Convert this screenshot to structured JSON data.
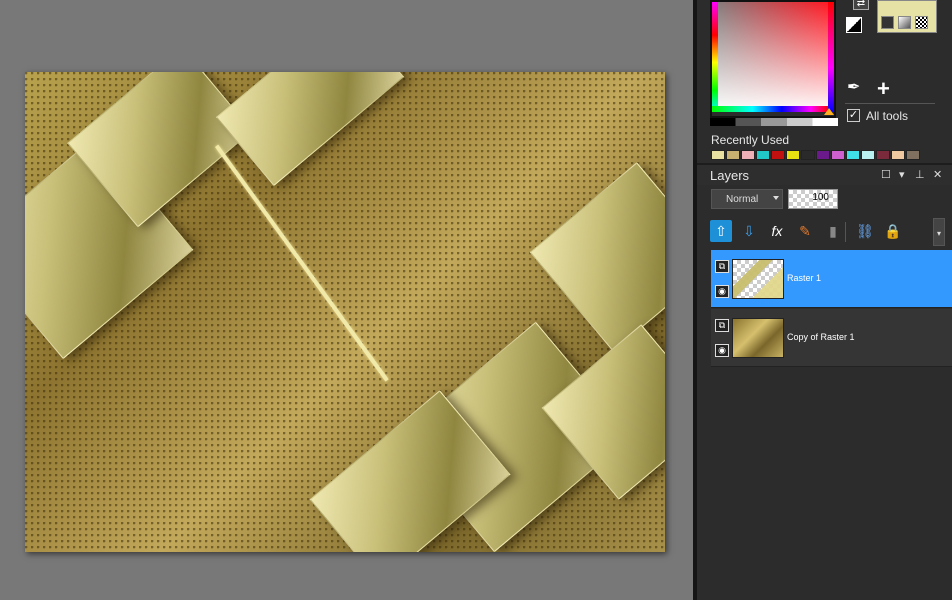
{
  "color_panel": {
    "all_tools_label": "All tools",
    "all_tools_checked": true,
    "recently_used_label": "Recently Used",
    "recent_colors": [
      "#e8e0a0",
      "#c8b070",
      "#f0b0b8",
      "#20c8c8",
      "#c01010",
      "#e8e010",
      "#2a2a2a",
      "#6a1a8a",
      "#d060d0",
      "#40e0e8",
      "#b8f0f0",
      "#7a2a3a",
      "#f0c8a0",
      "#807060"
    ],
    "foreground_color": "#e6e2a6"
  },
  "layers": {
    "title": "Layers",
    "blend_mode": "Normal",
    "opacity": "100",
    "items": [
      {
        "name": "Raster 1",
        "selected": true
      },
      {
        "name": "Copy of Raster 1",
        "selected": false
      }
    ]
  },
  "icons": {
    "new_layer": "arrow-up-icon",
    "merge_down": "arrow-down-icon",
    "effects": "fx-icon",
    "mask": "mask-icon",
    "delete": "trash-icon",
    "link": "link-icon",
    "lock": "lock-icon"
  }
}
